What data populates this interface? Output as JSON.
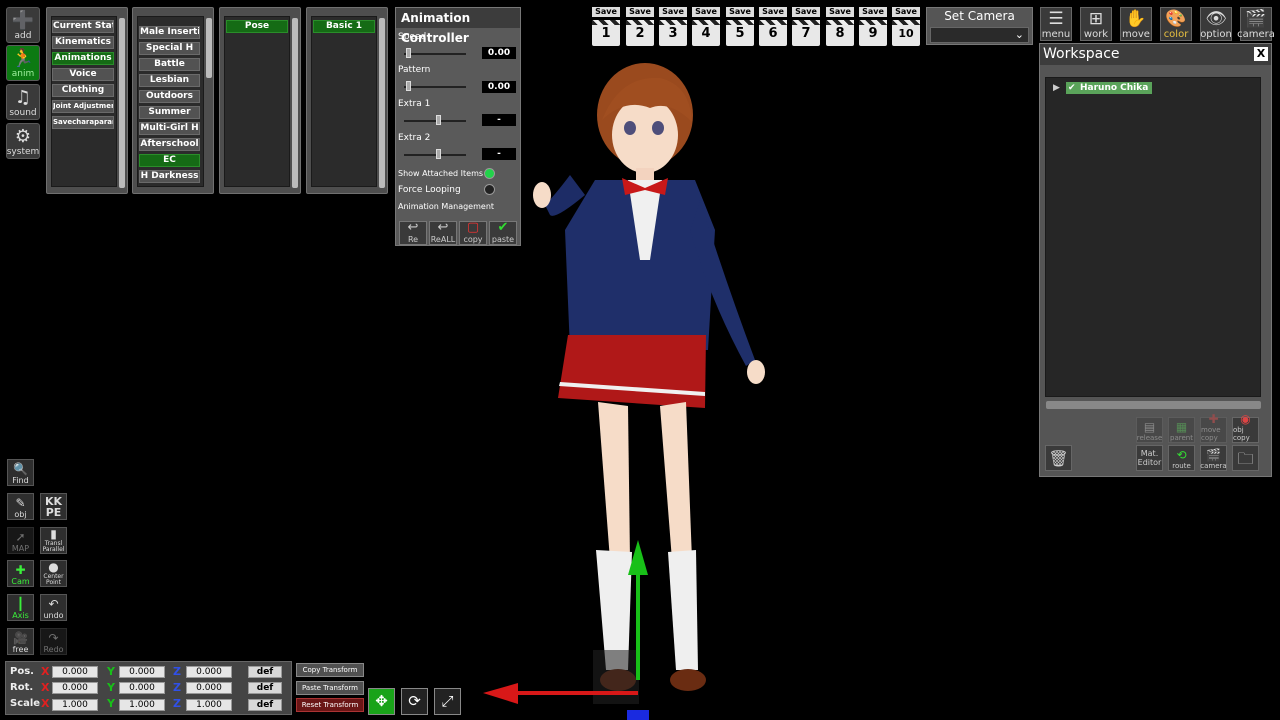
{
  "sidebar": {
    "buttons": [
      {
        "label": "add",
        "icon": "add-icon"
      },
      {
        "label": "anim",
        "icon": "anim-icon"
      },
      {
        "label": "sound",
        "icon": "sound-icon"
      },
      {
        "label": "system",
        "icon": "system-icon"
      }
    ]
  },
  "categories": [
    "Current State",
    "Kinematics",
    "Animations",
    "Voice",
    "Clothing",
    "Joint Adjustment",
    "Savecharaparam"
  ],
  "groups": [
    "Male Insertion",
    "Special H",
    "Battle",
    "Lesbian",
    "Outdoors",
    "Summer",
    "Multi-Girl H",
    "Afterschool",
    "EC",
    "H Darkness"
  ],
  "subgroups": [
    "Pose"
  ],
  "animations": [
    "Basic 1"
  ],
  "anim_ctrl": {
    "title": "Animation Controller",
    "speed_label": "Speed",
    "speed_value": "0.00",
    "pattern_label": "Pattern",
    "pattern_value": "0.00",
    "extra1_label": "Extra 1",
    "extra1_value": "-",
    "extra2_label": "Extra 2",
    "extra2_value": "-",
    "show_attached_label": "Show Attached Items",
    "force_looping_label": "Force Looping",
    "management_label": "Animation Management",
    "buttons": [
      "Re",
      "ReALL",
      "copy",
      "paste"
    ]
  },
  "saves": {
    "label": "Save",
    "numbers": [
      "1",
      "2",
      "3",
      "4",
      "5",
      "6",
      "7",
      "8",
      "9",
      "10"
    ]
  },
  "set_camera": {
    "title": "Set Camera"
  },
  "top_buttons": [
    "menu",
    "work",
    "move",
    "color",
    "option",
    "camera"
  ],
  "workspace": {
    "title": "Workspace",
    "close": "X",
    "node": "Haruno Chika",
    "buttons_row1": [
      "release",
      "parent",
      "move copy",
      "obj copy"
    ],
    "buttons_row2": [
      "Mat. Editor",
      "route",
      "camera"
    ]
  },
  "tools": {
    "find": "Find",
    "obj": "obj",
    "kkpe": "KK PE",
    "map": "MAP",
    "transl_parallel": "Transl Parallel",
    "cam": "Cam",
    "center_point": "Center Point",
    "axis": "Axis",
    "undo": "undo",
    "free": "free",
    "redo": "Redo"
  },
  "transform": {
    "pos_label": "Pos.",
    "rot_label": "Rot.",
    "scale_label": "Scale",
    "x": "X",
    "y": "Y",
    "z": "Z",
    "pos": [
      "0.000",
      "0.000",
      "0.000"
    ],
    "rot": [
      "0.000",
      "0.000",
      "0.000"
    ],
    "scale": [
      "1.000",
      "1.000",
      "1.000"
    ],
    "def_label": "def",
    "copy_label": "Copy Transform",
    "paste_label": "Paste Transform",
    "reset_label": "Reset Transform"
  },
  "colors": {
    "accent_green": "#156b15",
    "panel": "#4e4e4e",
    "axis_x": "#e02020",
    "axis_y": "#18c018",
    "axis_z": "#2040e0"
  }
}
